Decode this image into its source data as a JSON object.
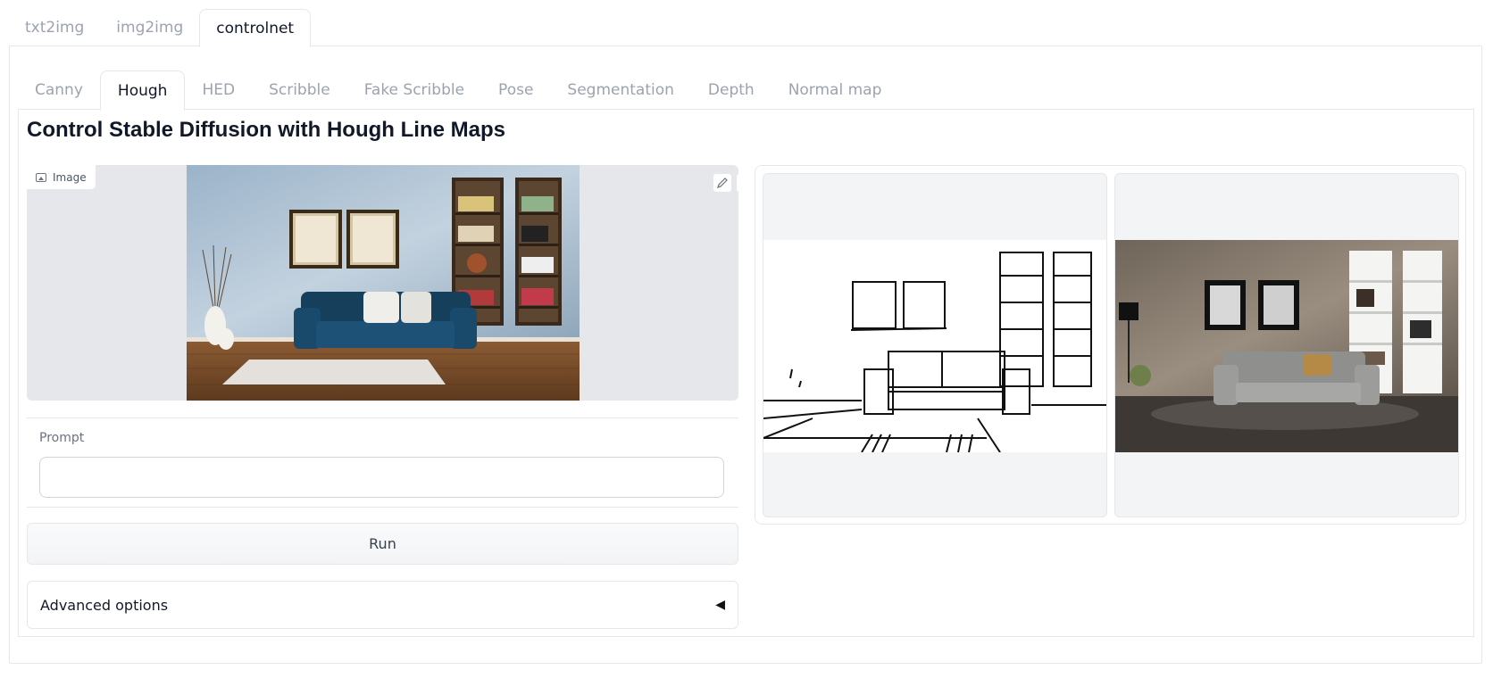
{
  "top_tabs": [
    "txt2img",
    "img2img",
    "controlnet"
  ],
  "active_top_tab": "controlnet",
  "sub_tabs": [
    "Canny",
    "Hough",
    "HED",
    "Scribble",
    "Fake Scribble",
    "Pose",
    "Segmentation",
    "Depth",
    "Normal map"
  ],
  "active_sub_tab": "Hough",
  "title": "Control Stable Diffusion with Hough Line Maps",
  "image_input": {
    "label": "Image",
    "edit_icon": "pencil-icon",
    "clear_icon": "close-icon"
  },
  "prompt": {
    "label": "Prompt",
    "value": "",
    "placeholder": ""
  },
  "run_label": "Run",
  "advanced_label": "Advanced options",
  "advanced_caret": "◀",
  "colors": {
    "border": "#e5e7eb",
    "muted_text": "#9ca3af",
    "panel_bg": "#f3f4f6"
  }
}
